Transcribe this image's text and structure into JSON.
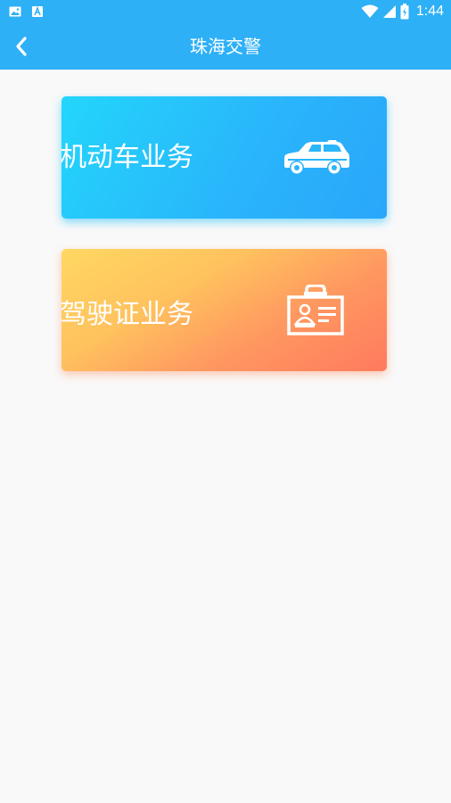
{
  "status_bar": {
    "time": "1:44",
    "icons": [
      "image-notification-icon",
      "a-notification-icon",
      "wifi-icon",
      "signal-icon",
      "battery-icon"
    ]
  },
  "header": {
    "title": "珠海交警",
    "back_icon": "chevron-left-icon",
    "background_color": "#2eb0f6"
  },
  "cards": [
    {
      "label": "机动车业务",
      "icon": "car-icon",
      "gradient": [
        "#23d6fb",
        "#2aa6fa"
      ]
    },
    {
      "label": "驾驶证业务",
      "icon": "id-card-icon",
      "gradient": [
        "#ffd862",
        "#ff7a5e"
      ]
    }
  ],
  "page_background": "#f9f9f9"
}
